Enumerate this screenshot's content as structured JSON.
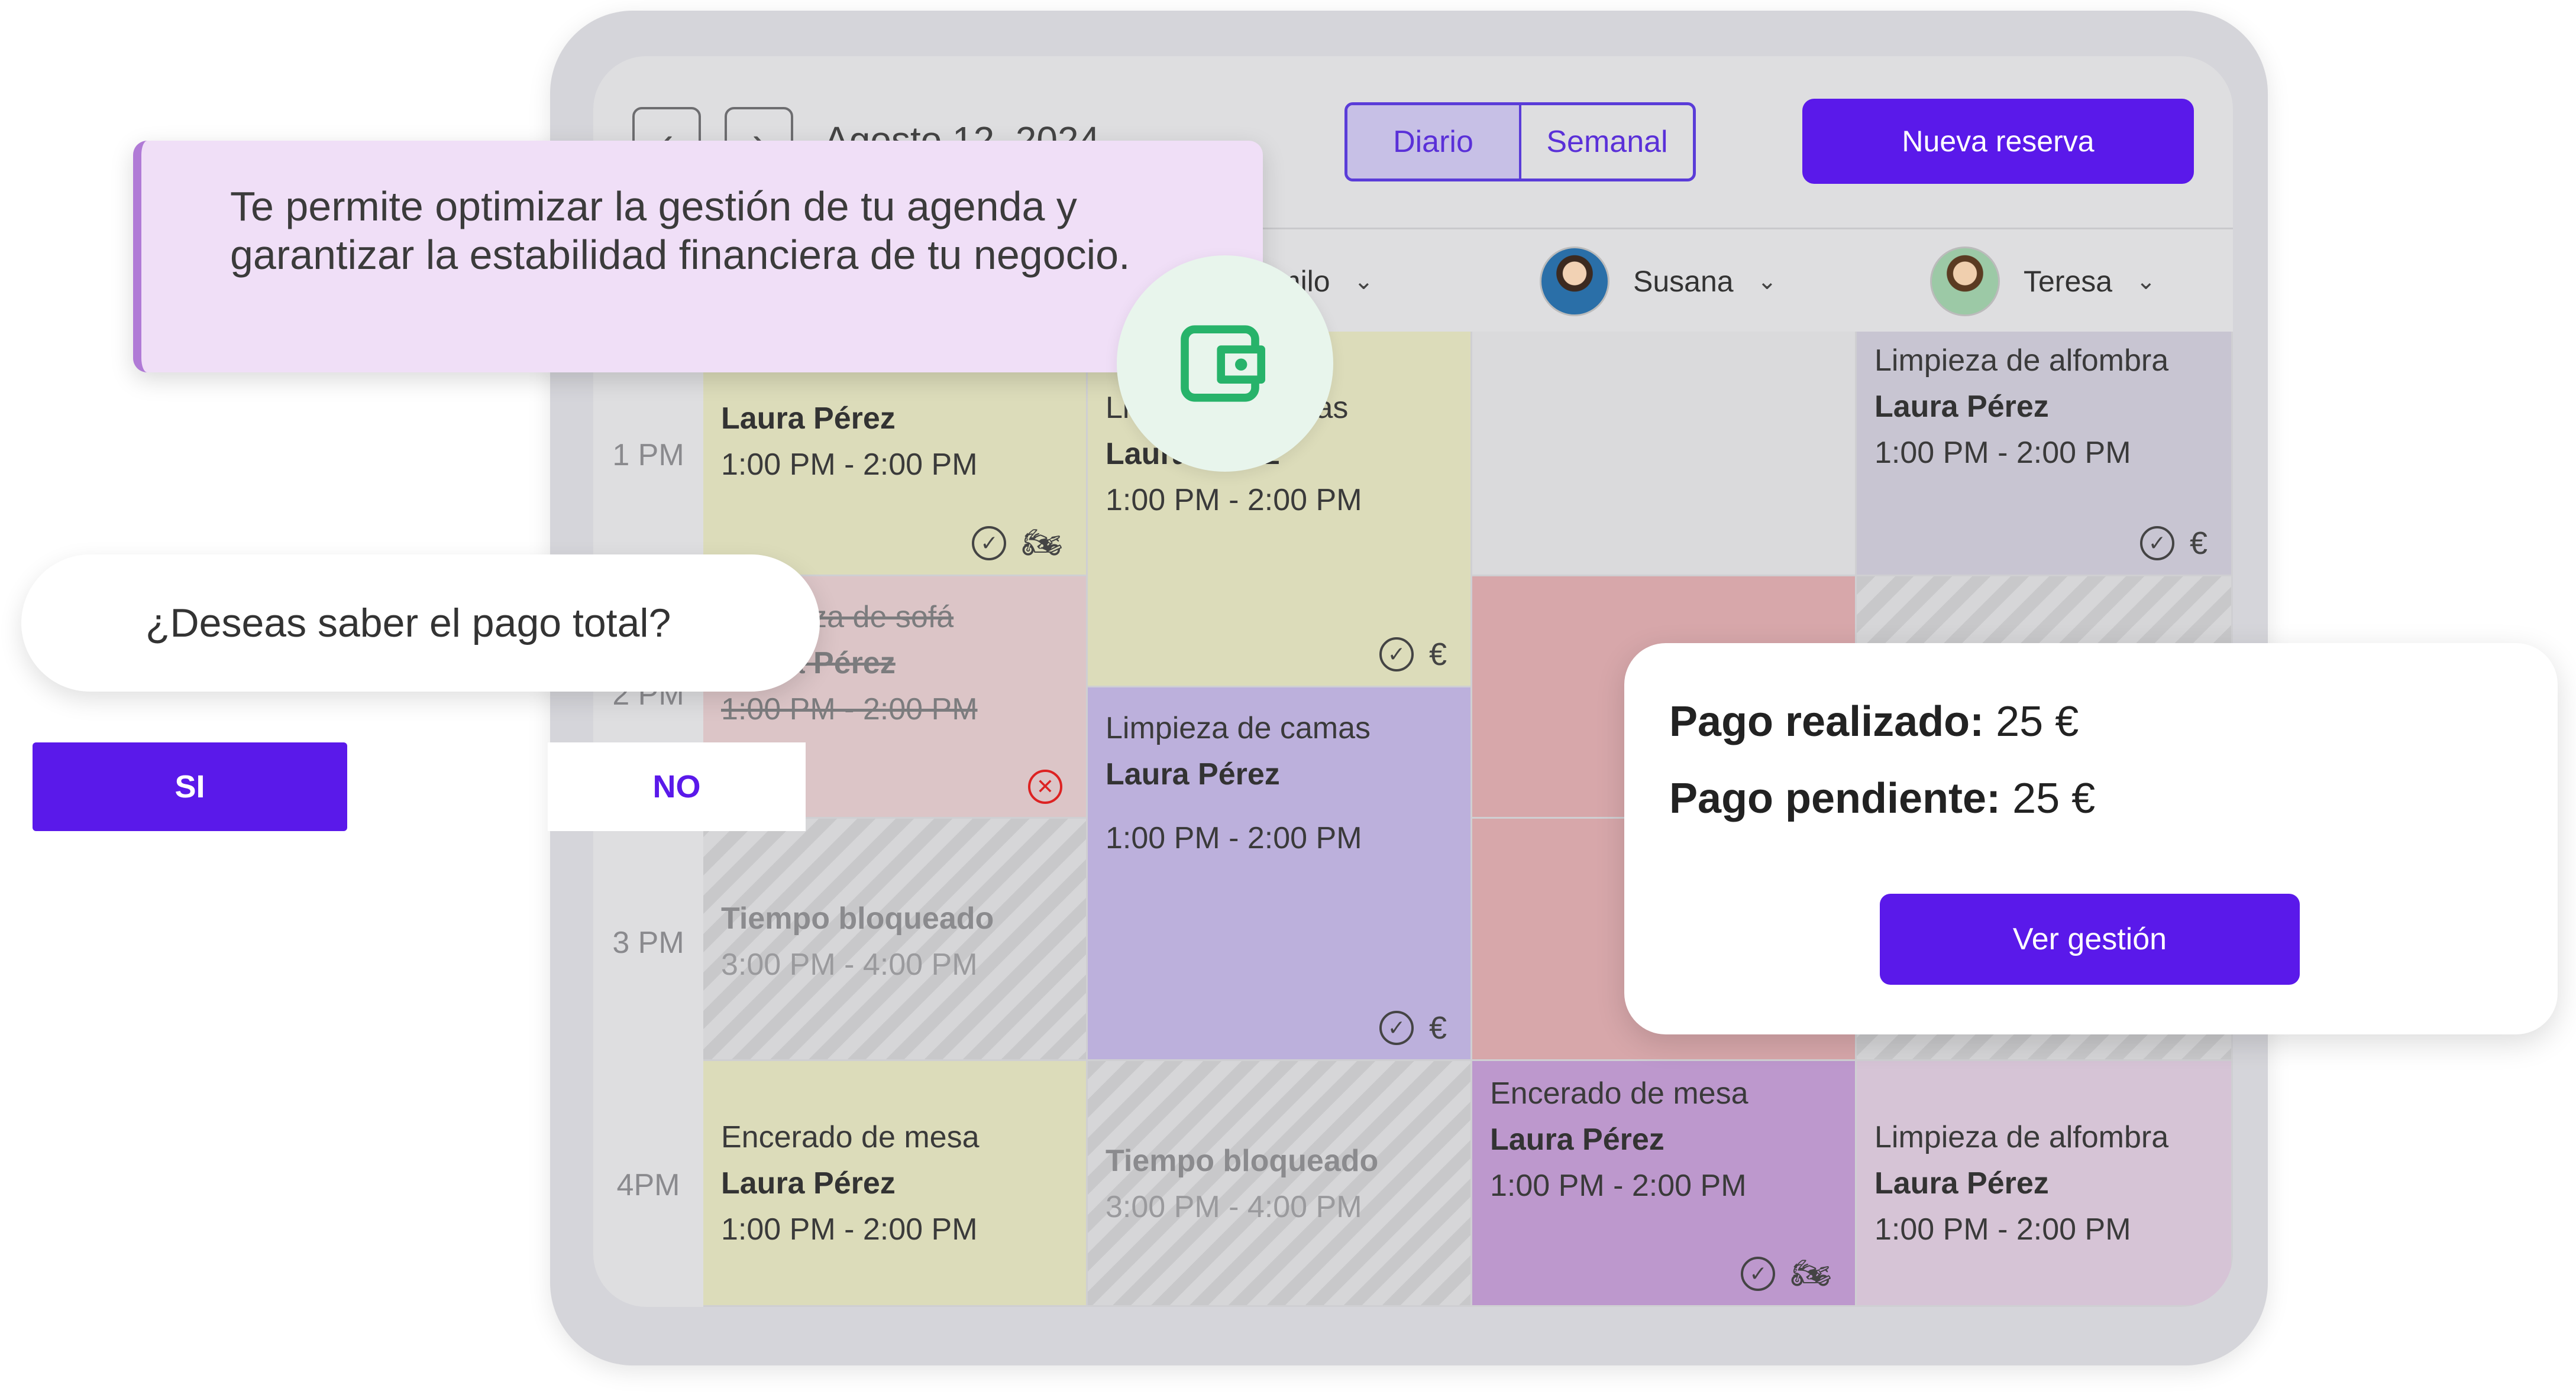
{
  "toolbar": {
    "date": "Agosto 12, 2024",
    "prev_icon": "chevron-left-icon",
    "next_icon": "chevron-right-icon",
    "views": [
      "Diario",
      "Semanal"
    ],
    "active_view": "Diario",
    "new_booking_label": "Nueva reserva"
  },
  "staff": [
    {
      "name": "Camilo"
    },
    {
      "name": "Susana"
    },
    {
      "name": "Teresa"
    }
  ],
  "times": [
    "1 PM",
    "2 PM",
    "3 PM",
    "4PM"
  ],
  "cells": {
    "c1a": {
      "client": "Laura Pérez",
      "time": "1:00 PM - 2:00 PM"
    },
    "c1b": {
      "service": "Limpieza de sofá",
      "client": "Laura Pérez",
      "time": "1:00 PM - 2:00 PM"
    },
    "c1c": {
      "title": "Tiempo bloqueado",
      "time": "3:00 PM - 4:00 PM"
    },
    "c1d": {
      "service": "Encerado de mesa",
      "client": "Laura Pérez",
      "time": "1:00 PM - 2:00 PM"
    },
    "c2a": {
      "service": "Limpieza de sillas",
      "client": "Laura Pérez",
      "time": "1:00 PM - 2:00 PM"
    },
    "c2b": {
      "service": "Limpieza de camas",
      "client": "Laura Pérez",
      "time": "1:00 PM - 2:00 PM"
    },
    "c2c": {
      "title": "Tiempo bloqueado",
      "time": "3:00 PM - 4:00 PM"
    },
    "c3d": {
      "service": "Encerado de mesa",
      "client": "Laura Pérez",
      "time": "1:00 PM - 2:00 PM"
    },
    "c4a": {
      "service": "Limpieza de alfombra",
      "client": "Laura Pérez",
      "time": "1:00 PM - 2:00 PM"
    },
    "c4d": {
      "service": "Limpieza de alfombra",
      "client": "Laura Pérez",
      "time": "1:00 PM - 2:00 PM"
    },
    "euro": "€"
  },
  "banner": {
    "text": "Te permite optimizar la gestión de tu agenda y garantizar la estabilidad financiera de tu negocio.",
    "icon": "wallet-icon"
  },
  "prompt": {
    "question": "¿Deseas saber el pago total?",
    "yes": "SI",
    "no": "NO"
  },
  "payment": {
    "done_label": "Pago realizado:",
    "done_value": "25 €",
    "pending_label": "Pago pendiente:",
    "pending_value": "25 €",
    "button": "Ver gestión"
  },
  "colors": {
    "accent": "#5a19ea",
    "wallet": "#27b36a"
  }
}
